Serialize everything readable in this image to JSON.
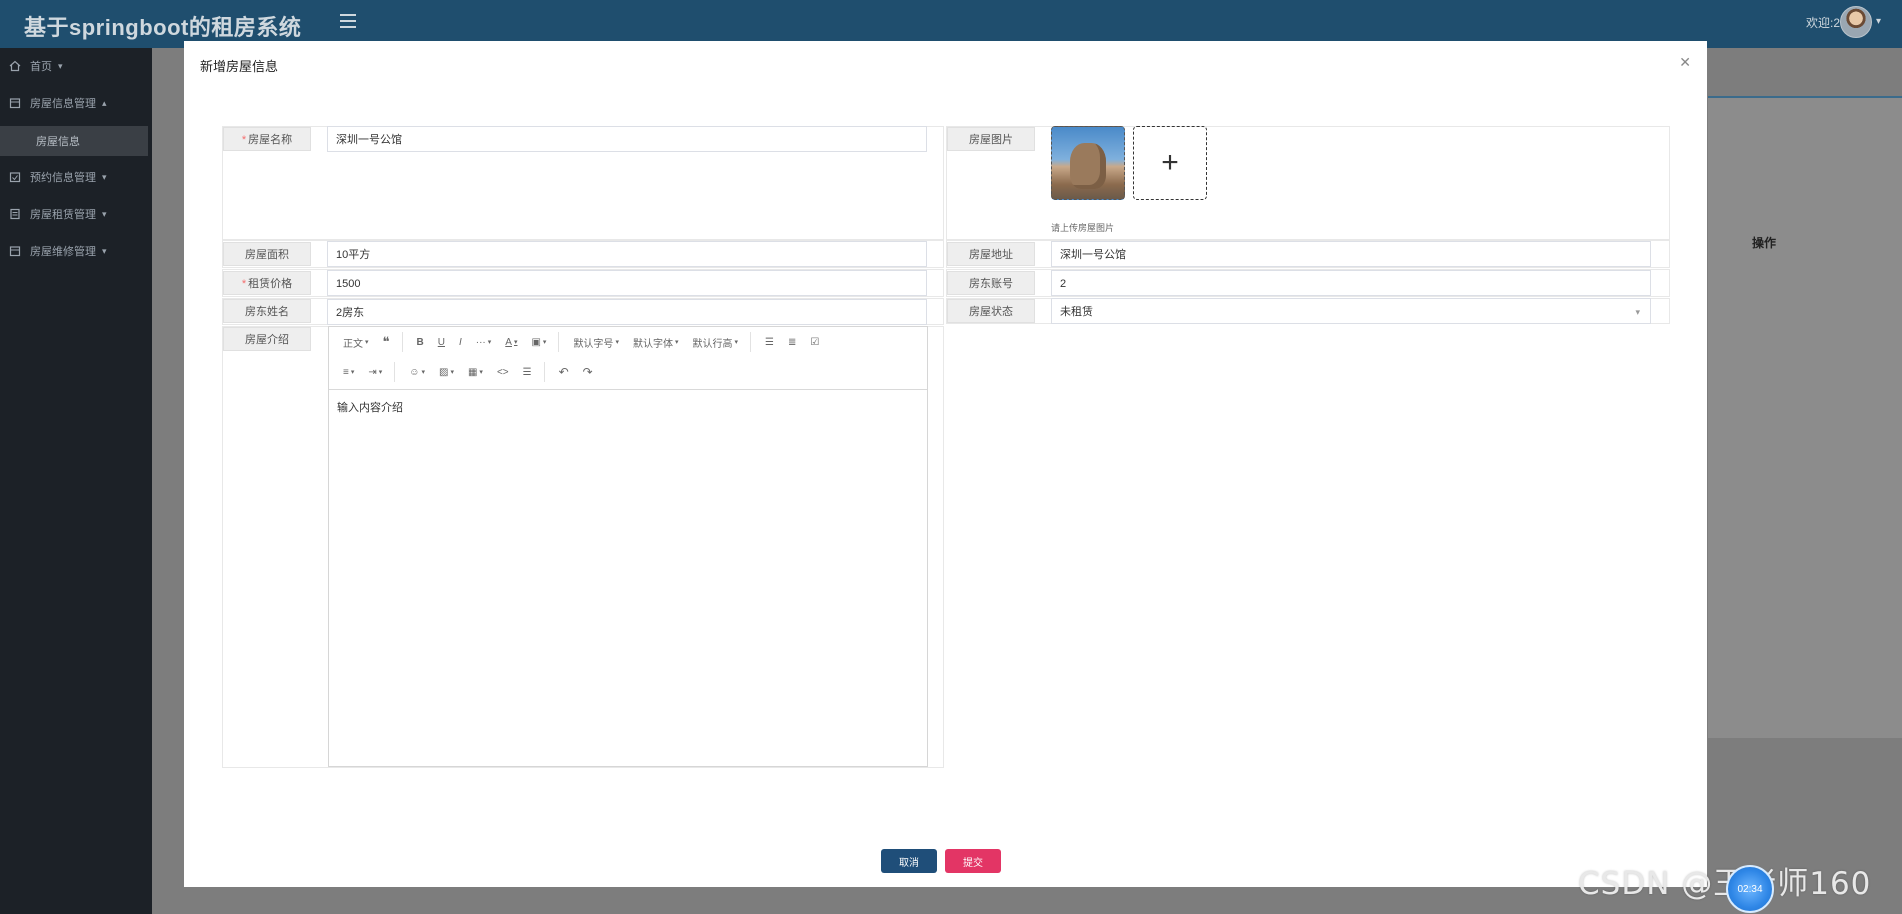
{
  "app": {
    "title": "基于springboot的租房系统",
    "welcome": "欢迎:2"
  },
  "sidebar": {
    "items": [
      {
        "label": "首页",
        "icon": "home-icon"
      },
      {
        "label": "房屋信息管理",
        "icon": "building-icon",
        "sub": "房屋信息"
      },
      {
        "label": "预约信息管理",
        "icon": "calendar-icon"
      },
      {
        "label": "房屋租赁管理",
        "icon": "document-icon"
      },
      {
        "label": "房屋维修管理",
        "icon": "tool-icon"
      }
    ]
  },
  "background": {
    "operation_header": "操作"
  },
  "dialog": {
    "title": "新增房屋信息",
    "fields": {
      "name": {
        "label": "房屋名称",
        "value": "深圳一号公馆",
        "required": true
      },
      "image": {
        "label": "房屋图片",
        "tip": "请上传房屋图片"
      },
      "area": {
        "label": "房屋面积",
        "value": "10平方"
      },
      "address": {
        "label": "房屋地址",
        "value": "深圳一号公馆"
      },
      "price": {
        "label": "租赁价格",
        "value": "1500",
        "required": true
      },
      "landlord_account": {
        "label": "房东账号",
        "value": "2"
      },
      "landlord_name": {
        "label": "房东姓名",
        "value": "2房东"
      },
      "status": {
        "label": "房屋状态",
        "value": "未租赁"
      },
      "intro": {
        "label": "房屋介绍",
        "placeholder": "输入内容介绍"
      }
    },
    "editor_toolbar": {
      "paragraph": "正文",
      "font_size": "默认字号",
      "font_family": "默认字体",
      "line_height": "默认行高"
    },
    "buttons": {
      "cancel": "取消",
      "submit": "提交"
    }
  },
  "overlay": {
    "watermark": "CSDN @王老师160",
    "timer": "02:34"
  },
  "colors": {
    "topbar": "#1f4e6e",
    "sidebar": "#1c2127",
    "cancel": "#1f4e79",
    "submit": "#e33565",
    "required": "#f56c6c"
  }
}
